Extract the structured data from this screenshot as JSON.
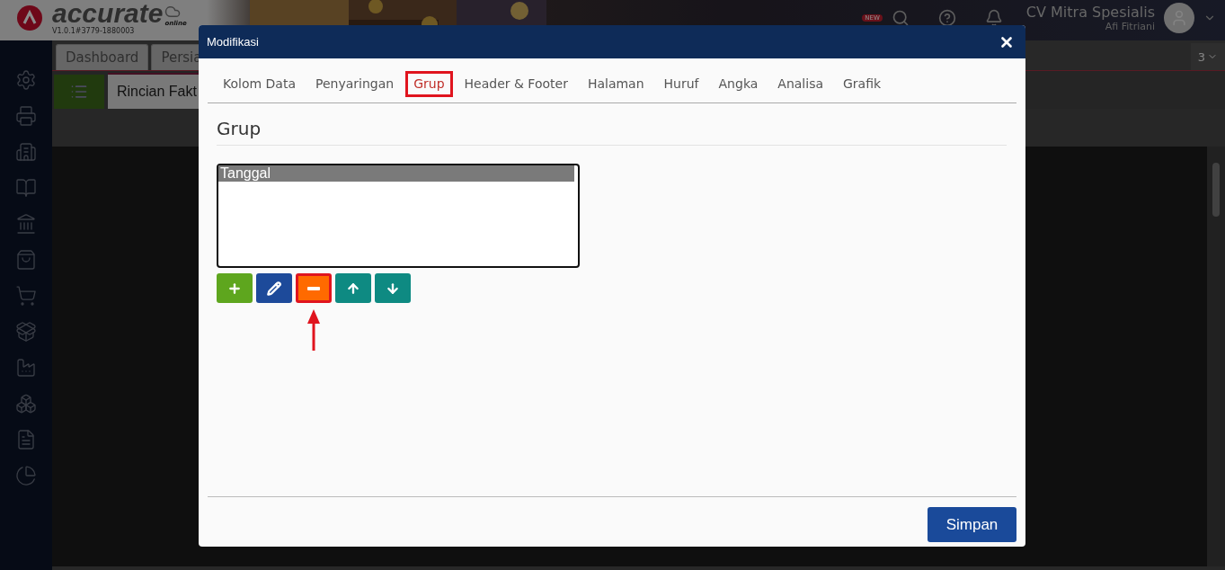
{
  "app": {
    "logo": "accurate",
    "logo_sub": "online",
    "version": "V1.0.1#3779-1880003",
    "new_badge": "NEW",
    "company": "CV Mitra Spesialis",
    "user": "Afi Fitriani"
  },
  "tabs": [
    {
      "label": "Dashboard"
    },
    {
      "label": "Persia"
    }
  ],
  "tab_count": "3",
  "page_tab": "Rincian Fakt",
  "dialog": {
    "title": "Modifikasi",
    "tabs": [
      {
        "label": "Kolom Data",
        "selected": false,
        "highlighted": false
      },
      {
        "label": "Penyaringan",
        "selected": false,
        "highlighted": false
      },
      {
        "label": "Grup",
        "selected": true,
        "highlighted": true
      },
      {
        "label": "Header & Footer",
        "selected": false,
        "highlighted": false
      },
      {
        "label": "Halaman",
        "selected": false,
        "highlighted": false
      },
      {
        "label": "Huruf",
        "selected": false,
        "highlighted": false
      },
      {
        "label": "Angka",
        "selected": false,
        "highlighted": false
      },
      {
        "label": "Analisa",
        "selected": false,
        "highlighted": false
      },
      {
        "label": "Grafik",
        "selected": false,
        "highlighted": false
      }
    ],
    "section_title": "Grup",
    "list": [
      {
        "label": "Tanggal",
        "selected": true
      }
    ],
    "buttons": [
      {
        "kind": "add",
        "highlighted": false
      },
      {
        "kind": "edit",
        "highlighted": false
      },
      {
        "kind": "remove",
        "highlighted": true
      },
      {
        "kind": "up",
        "highlighted": false
      },
      {
        "kind": "down",
        "highlighted": false
      }
    ],
    "save": "Simpan"
  }
}
